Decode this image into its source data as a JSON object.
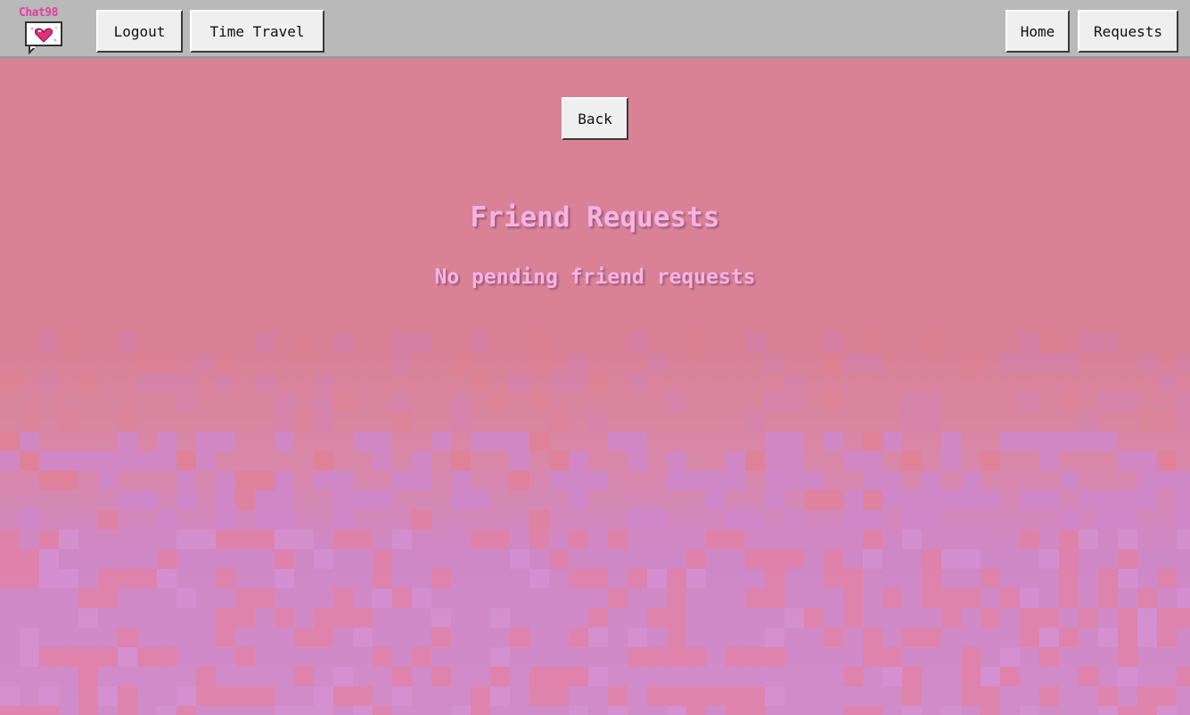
{
  "app": {
    "logo_text": "Chat98"
  },
  "toolbar": {
    "logout_label": "Logout",
    "time_travel_label": "Time Travel",
    "home_label": "Home",
    "requests_label": "Requests"
  },
  "main": {
    "back_label": "Back",
    "title": "Friend Requests",
    "empty_message": "No pending friend requests"
  },
  "colors": {
    "toolbar_bg": "#b9b9b9",
    "page_pink": "#d98296",
    "page_purple": "#d08cc8",
    "heading_pink": "#f7b3e3",
    "logo_magenta": "#e040a0"
  },
  "icons": {
    "logo": "chat-bubble-heart-icon"
  }
}
